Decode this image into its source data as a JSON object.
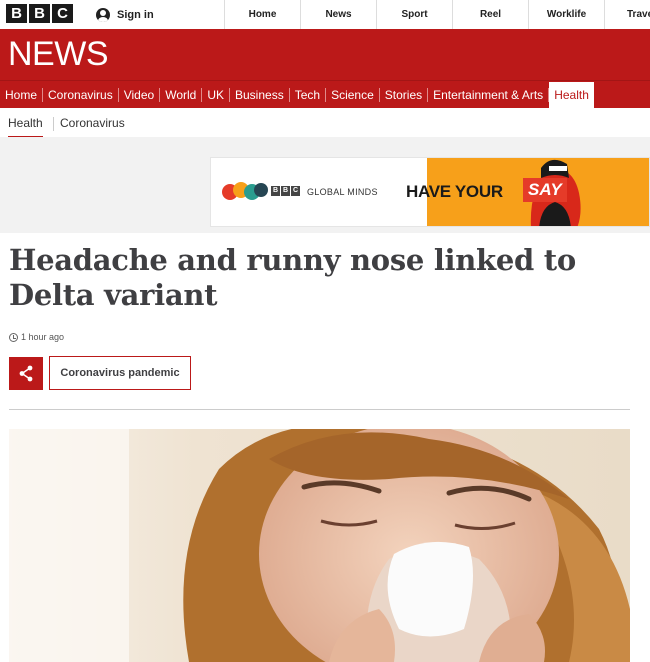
{
  "top": {
    "brand": [
      "B",
      "B",
      "C"
    ],
    "signin": "Sign in",
    "nav": [
      "Home",
      "News",
      "Sport",
      "Reel",
      "Worklife",
      "Travel"
    ]
  },
  "section": {
    "title": "NEWS"
  },
  "categories": [
    "Home",
    "Coronavirus",
    "Video",
    "World",
    "UK",
    "Business",
    "Tech",
    "Science",
    "Stories",
    "Entertainment & Arts",
    "Health"
  ],
  "subnav": [
    "Health",
    "Coronavirus"
  ],
  "ad": {
    "brand": [
      "B",
      "B",
      "C"
    ],
    "program": "GLOBAL MINDS",
    "tagline": "HAVE YOUR",
    "tagline_highlight": "SAY"
  },
  "article": {
    "headline": "Headache and runny nose linked to Delta variant",
    "timestamp": "1 hour ago",
    "topic": "Coronavirus pandemic"
  },
  "colors": {
    "brand_red": "#bb1919",
    "ad_orange": "#f7a01a",
    "headline": "#3f3f42"
  },
  "icons": {
    "signin": "user-icon",
    "timestamp": "clock-icon",
    "share": "share-icon"
  }
}
